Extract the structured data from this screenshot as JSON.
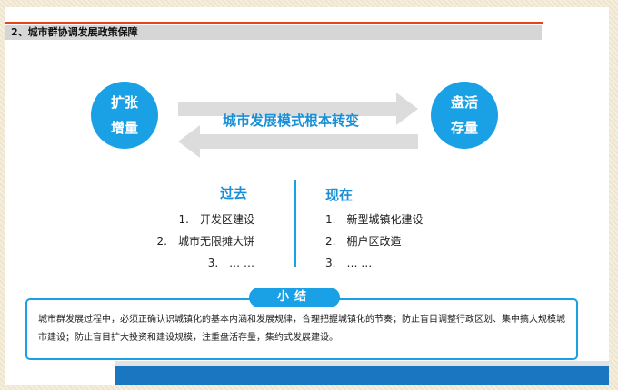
{
  "slide": {
    "title": "2、城市群协调发展政策保障"
  },
  "circles": {
    "left": [
      "扩张",
      "增量"
    ],
    "right": [
      "盘活",
      "存量"
    ]
  },
  "center": {
    "text": "城市发展模式根本转变"
  },
  "past": {
    "heading": "过去",
    "items": [
      {
        "num": "1.",
        "text": "开发区建设"
      },
      {
        "num": "2.",
        "text": "城市无限摊大饼"
      },
      {
        "num": "3.",
        "text": "… …"
      }
    ]
  },
  "now": {
    "heading": "现在",
    "items": [
      {
        "num": "1.",
        "text": "新型城镇化建设"
      },
      {
        "num": "2.",
        "text": "棚户区改造"
      },
      {
        "num": "3.",
        "text": "… …"
      }
    ]
  },
  "summary": {
    "tag": "小结",
    "text": "城市群发展过程中，必须正确认识城镇化的基本内涵和发展规律，合理把握城镇化的节奏；防止盲目调整行政区划、集中搞大规模城市建设；防止盲目扩大投资和建设规模，注重盘活存量，集约式发展建设。"
  },
  "colors": {
    "accent": "#1aa1e5",
    "title_line": "#e8431f",
    "bottom_bar": "#1b76c2"
  }
}
